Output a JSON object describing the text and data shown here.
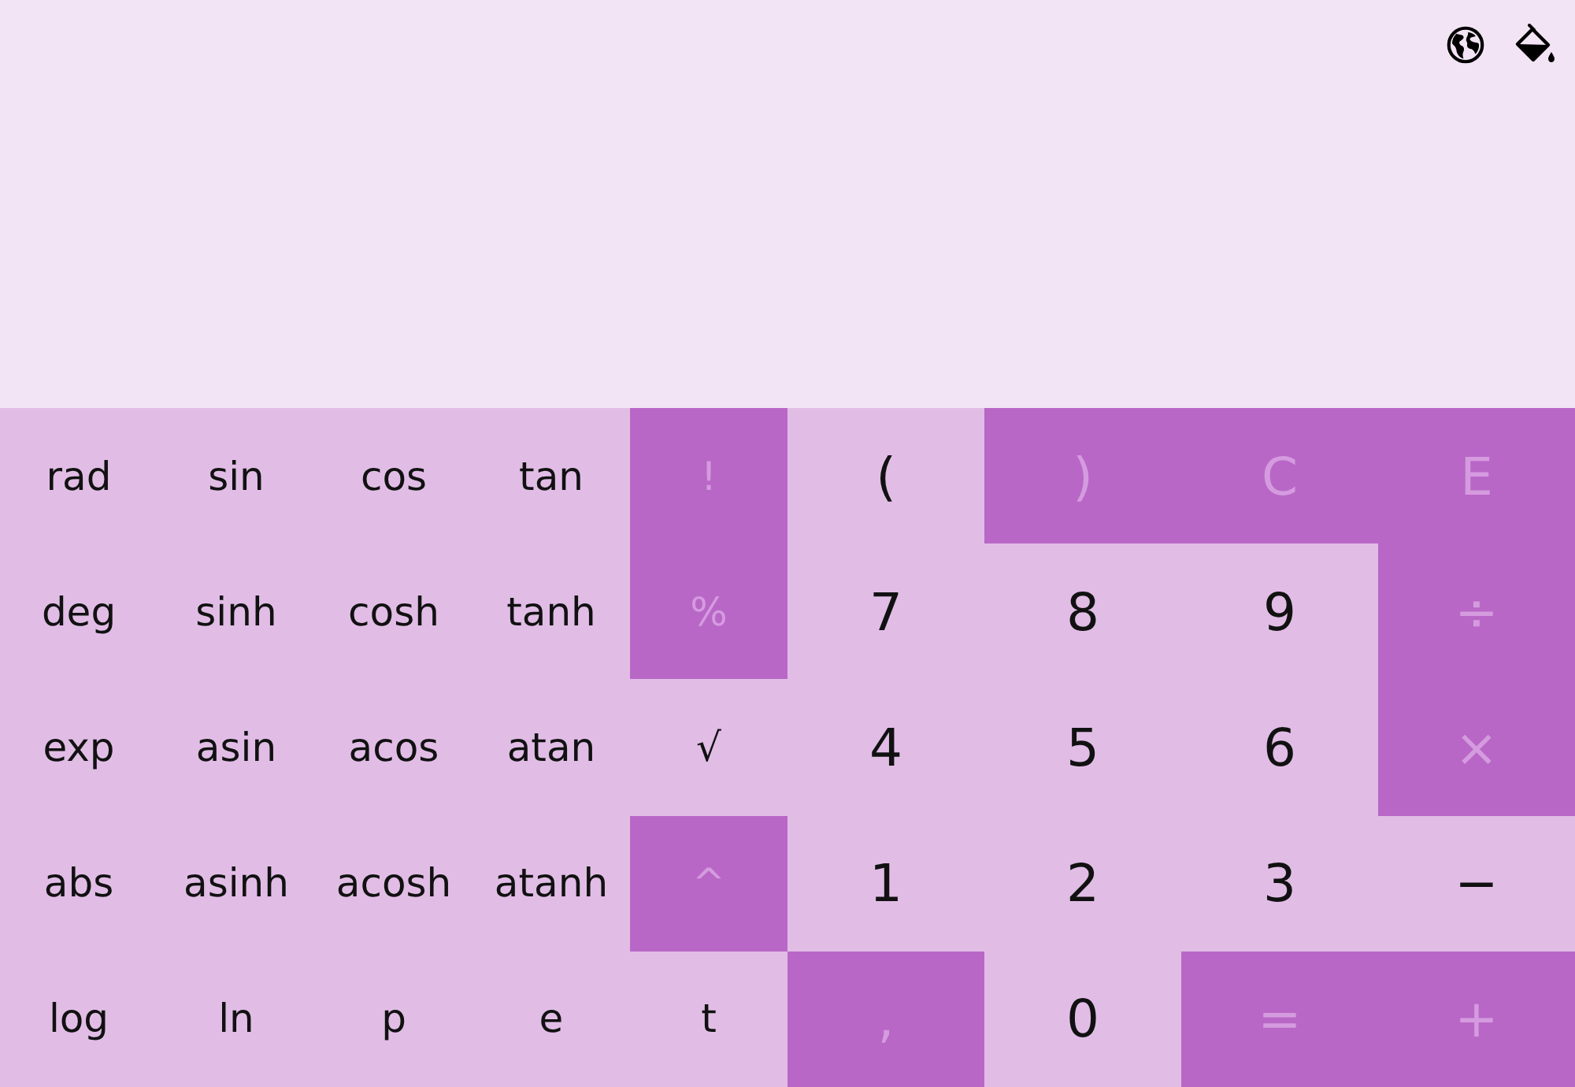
{
  "toolbar": {
    "icons": [
      {
        "kind": "globe"
      },
      {
        "kind": "paint-bucket"
      }
    ]
  },
  "keypad": {
    "rows": [
      [
        {
          "label": "rad",
          "disabled": false
        },
        {
          "label": "sin",
          "disabled": false
        },
        {
          "label": "cos",
          "disabled": false
        },
        {
          "label": "tan",
          "disabled": false
        },
        {
          "label": "!",
          "disabled": true
        },
        {
          "label": "(",
          "disabled": false
        },
        {
          "label": ")",
          "disabled": true
        },
        {
          "label": "C",
          "disabled": true
        },
        {
          "label": "E",
          "disabled": true
        }
      ],
      [
        {
          "label": "deg",
          "disabled": false
        },
        {
          "label": "sinh",
          "disabled": false
        },
        {
          "label": "cosh",
          "disabled": false
        },
        {
          "label": "tanh",
          "disabled": false
        },
        {
          "label": "%",
          "disabled": true
        },
        {
          "label": "7",
          "disabled": false
        },
        {
          "label": "8",
          "disabled": false
        },
        {
          "label": "9",
          "disabled": false
        },
        {
          "label": "÷",
          "disabled": true
        }
      ],
      [
        {
          "label": "exp",
          "disabled": false
        },
        {
          "label": "asin",
          "disabled": false
        },
        {
          "label": "acos",
          "disabled": false
        },
        {
          "label": "atan",
          "disabled": false
        },
        {
          "label": "√",
          "disabled": false
        },
        {
          "label": "4",
          "disabled": false
        },
        {
          "label": "5",
          "disabled": false
        },
        {
          "label": "6",
          "disabled": false
        },
        {
          "label": "×",
          "disabled": true
        }
      ],
      [
        {
          "label": "abs",
          "disabled": false
        },
        {
          "label": "asinh",
          "disabled": false
        },
        {
          "label": "acosh",
          "disabled": false
        },
        {
          "label": "atanh",
          "disabled": false
        },
        {
          "label": "^",
          "disabled": true
        },
        {
          "label": "1",
          "disabled": false
        },
        {
          "label": "2",
          "disabled": false
        },
        {
          "label": "3",
          "disabled": false
        },
        {
          "label": "−",
          "disabled": false
        }
      ],
      [
        {
          "label": "log",
          "disabled": false
        },
        {
          "label": "ln",
          "disabled": false
        },
        {
          "label": "p",
          "disabled": false
        },
        {
          "label": "e",
          "disabled": false
        },
        {
          "label": "t",
          "disabled": false
        },
        {
          "label": ",",
          "disabled": true
        },
        {
          "label": "0",
          "disabled": false
        },
        {
          "label": "=",
          "disabled": true
        },
        {
          "label": "+",
          "disabled": true
        }
      ]
    ]
  }
}
